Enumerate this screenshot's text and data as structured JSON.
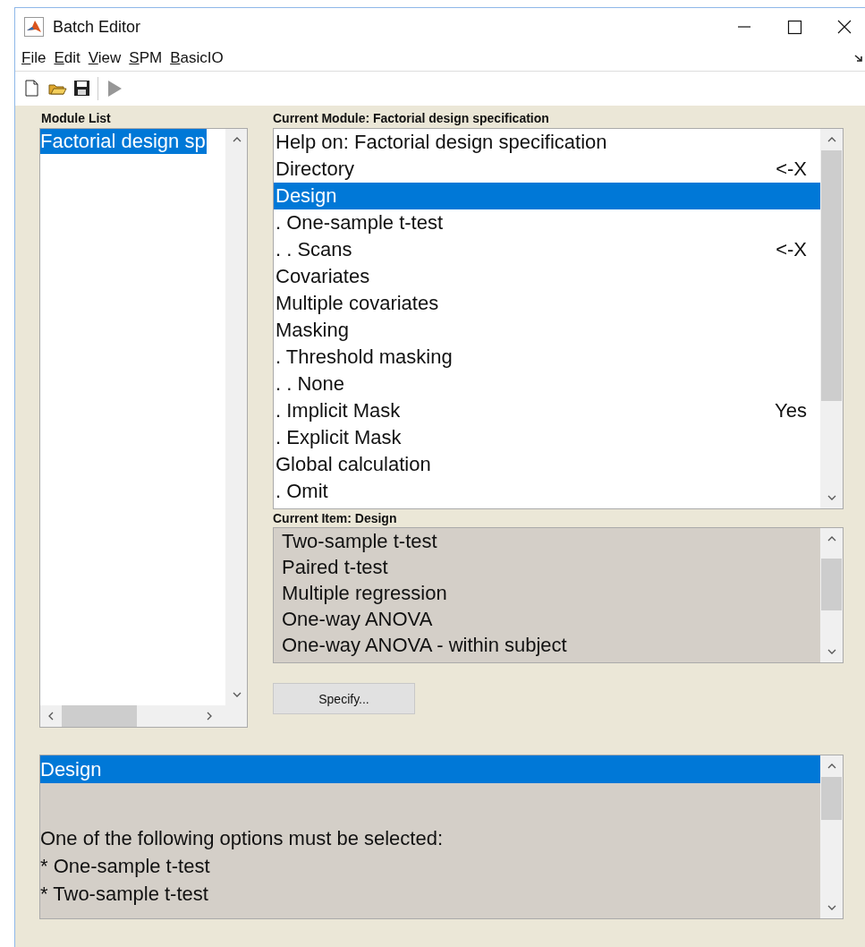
{
  "window": {
    "title": "Batch Editor"
  },
  "menu": [
    "File",
    "Edit",
    "View",
    "SPM",
    "BasicIO"
  ],
  "toolbar": [
    {
      "kind": "new",
      "disabled": false
    },
    {
      "kind": "open",
      "disabled": false
    },
    {
      "kind": "save",
      "disabled": false
    },
    {
      "kind": "run",
      "disabled": true
    }
  ],
  "module_list": {
    "label": "Module List",
    "items": [
      {
        "text": "Factorial design sp",
        "selected": true
      }
    ]
  },
  "current_module": {
    "label": "Current Module: Factorial design specification",
    "rows": [
      {
        "text": "Help on: Factorial design specification",
        "value": "",
        "selected": false
      },
      {
        "text": "Directory",
        "value": "<-X",
        "selected": false
      },
      {
        "text": "Design",
        "selected": true
      },
      {
        "text": ". One-sample t-test",
        "selected": false
      },
      {
        "text": ". . Scans",
        "value": "<-X",
        "selected": false
      },
      {
        "text": "Covariates",
        "selected": false
      },
      {
        "text": "Multiple covariates",
        "selected": false
      },
      {
        "text": "Masking",
        "selected": false
      },
      {
        "text": ". Threshold masking",
        "selected": false
      },
      {
        "text": ". . None",
        "selected": false
      },
      {
        "text": ". Implicit Mask",
        "value": "Yes",
        "selected": false
      },
      {
        "text": ". Explicit Mask",
        "selected": false
      },
      {
        "text": "Global calculation",
        "selected": false
      },
      {
        "text": ". Omit",
        "selected": false
      }
    ]
  },
  "current_item": {
    "label": "Current Item: Design",
    "options": [
      {
        "text": "Two-sample t-test",
        "selected": false
      },
      {
        "text": "Paired t-test",
        "selected": false
      },
      {
        "text": "Multiple regression",
        "selected": false
      },
      {
        "text": "One-way ANOVA",
        "selected": false
      },
      {
        "text": "One-way ANOVA - within subject",
        "selected": false
      }
    ]
  },
  "specify_button": "Specify...",
  "help": {
    "lines": [
      {
        "text": "Design",
        "selected": true
      },
      {
        "text": "One of the following options must be selected:",
        "selected": false
      },
      {
        "text": "* One-sample t-test",
        "selected": false
      },
      {
        "text": "* Two-sample t-test",
        "selected": false
      }
    ]
  }
}
